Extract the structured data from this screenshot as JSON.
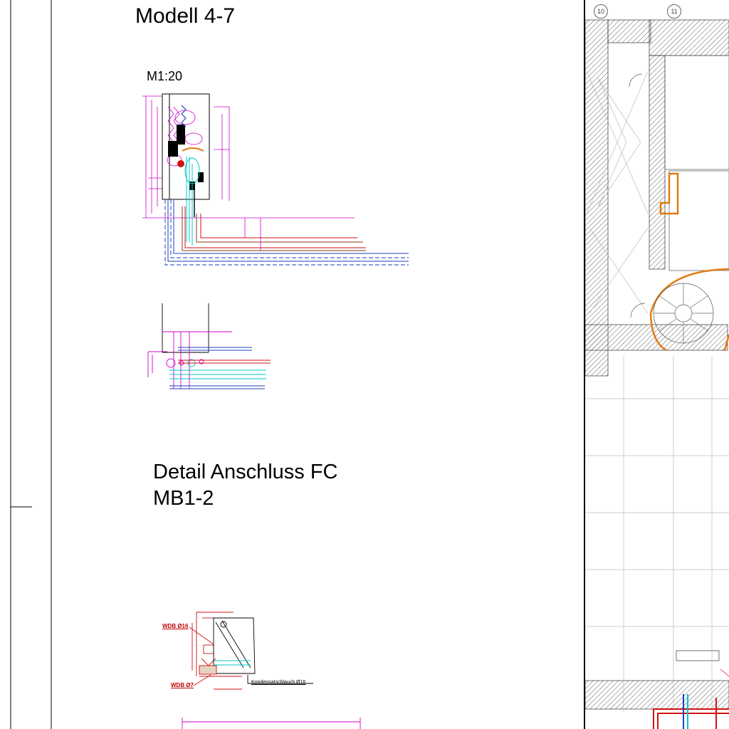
{
  "titles": {
    "model": "Modell 4-7",
    "scale": "M1:20",
    "detail_line1": "Detail Anschluss FC",
    "detail_line2": "MB1-2"
  },
  "labels": {
    "wdb_16": "WDB Ø16",
    "wdb_7": "WDB Ø7",
    "condensate": "Kondensatschlauch Ø16"
  },
  "grid_axes": {
    "axis_10": "10",
    "axis_11": "11"
  },
  "colors": {
    "magenta": "#d000d0",
    "blue": "#1f3fbf",
    "cyan": "#00c8c8",
    "red": "#d01010",
    "orange": "#e07b10",
    "brown": "#8b3a1a",
    "hatch": "#888888"
  }
}
